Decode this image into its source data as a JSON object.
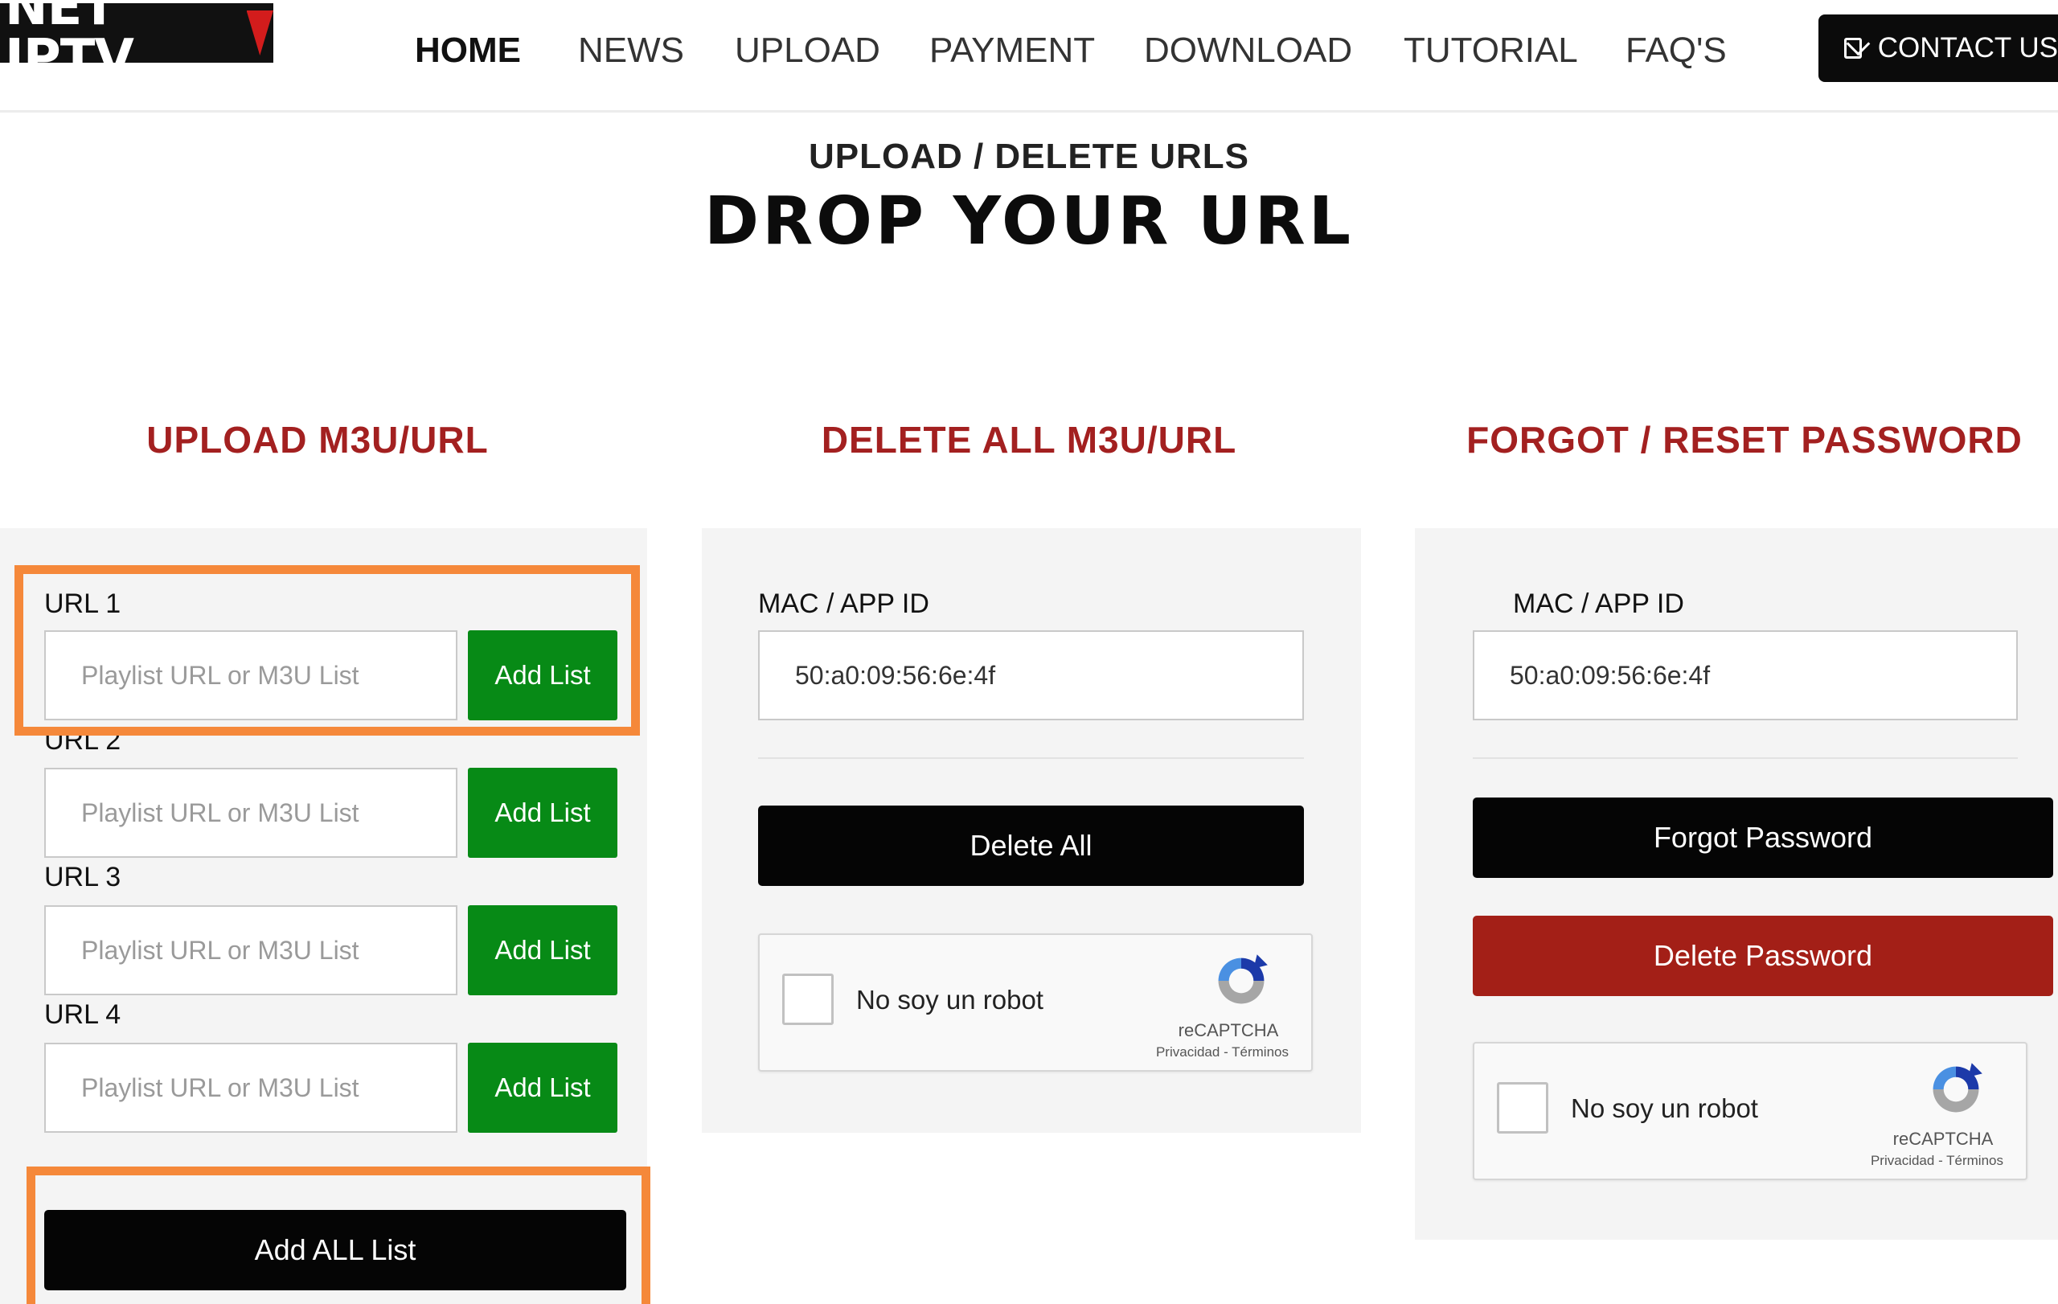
{
  "brand": {
    "logo_text": "NET IPTV"
  },
  "nav": {
    "items": [
      {
        "label": "HOME",
        "active": true
      },
      {
        "label": "NEWS"
      },
      {
        "label": "UPLOAD"
      },
      {
        "label": "PAYMENT"
      },
      {
        "label": "DOWNLOAD"
      },
      {
        "label": "TUTORIAL"
      },
      {
        "label": "FAQ'S"
      }
    ],
    "contact_label": "CONTACT US"
  },
  "hero": {
    "subtitle": "UPLOAD / DELETE URLS",
    "title": "DROP YOUR URL"
  },
  "upload": {
    "heading": "UPLOAD M3U/URL",
    "urls": [
      {
        "label": "URL 1",
        "placeholder": "Playlist URL or M3U List",
        "button": "Add List"
      },
      {
        "label": "URL 2",
        "placeholder": "Playlist URL or M3U List",
        "button": "Add List"
      },
      {
        "label": "URL 3",
        "placeholder": "Playlist URL or M3U List",
        "button": "Add List"
      },
      {
        "label": "URL 4",
        "placeholder": "Playlist URL or M3U List",
        "button": "Add List"
      }
    ],
    "add_all_label": "Add ALL List"
  },
  "delete_all": {
    "heading": "DELETE ALL M3U/URL",
    "field_label": "MAC / APP ID",
    "mac_value": "50:a0:09:56:6e:4f",
    "button": "Delete All",
    "captcha": {
      "label": "No soy un robot",
      "brand": "reCAPTCHA",
      "terms": "Privacidad - Términos"
    }
  },
  "password": {
    "heading": "FORGOT / RESET PASSWORD",
    "field_label": "MAC / APP ID",
    "mac_value": "50:a0:09:56:6e:4f",
    "forgot_button": "Forgot Password",
    "delete_button": "Delete Password",
    "captcha": {
      "label": "No soy un robot",
      "brand": "reCAPTCHA",
      "terms": "Privacidad - Términos"
    }
  },
  "colors": {
    "heading_red": "#a32020",
    "add_green": "#078a16",
    "delete_red": "#a31f17",
    "highlight_orange": "#f5883a"
  }
}
